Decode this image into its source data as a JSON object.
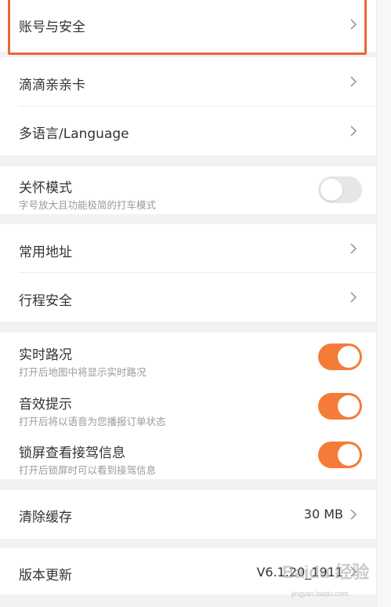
{
  "settings": {
    "account_security": "账号与安全",
    "didi_card": "滴滴亲亲卡",
    "language": "多语言/Language",
    "care_mode": {
      "label": "关怀模式",
      "desc": "字号放大且功能极简的打车模式",
      "enabled": false
    },
    "common_address": "常用地址",
    "trip_safety": "行程安全",
    "realtime_traffic": {
      "label": "实时路况",
      "desc": "打开后地图中将显示实时路况",
      "enabled": true
    },
    "sound_prompt": {
      "label": "音效提示",
      "desc": "打开后将以语音为您播报订单状态",
      "enabled": true
    },
    "lockscreen_info": {
      "label": "锁屏查看接驾信息",
      "desc": "打开后锁屏时可以看到接驾信息",
      "enabled": true
    },
    "clear_cache": {
      "label": "清除缓存",
      "value": "30 MB"
    },
    "version_update": {
      "label": "版本更新",
      "value": "V6.1.20_1911"
    }
  },
  "watermark": {
    "text": "Baidu 经验",
    "url": "jingyan.baidu.com"
  },
  "colors": {
    "accent": "#f47c38",
    "highlight_border": "#e8683a",
    "background": "#f2f2f2"
  },
  "icons": {
    "chevron": "chevron-right-icon"
  }
}
